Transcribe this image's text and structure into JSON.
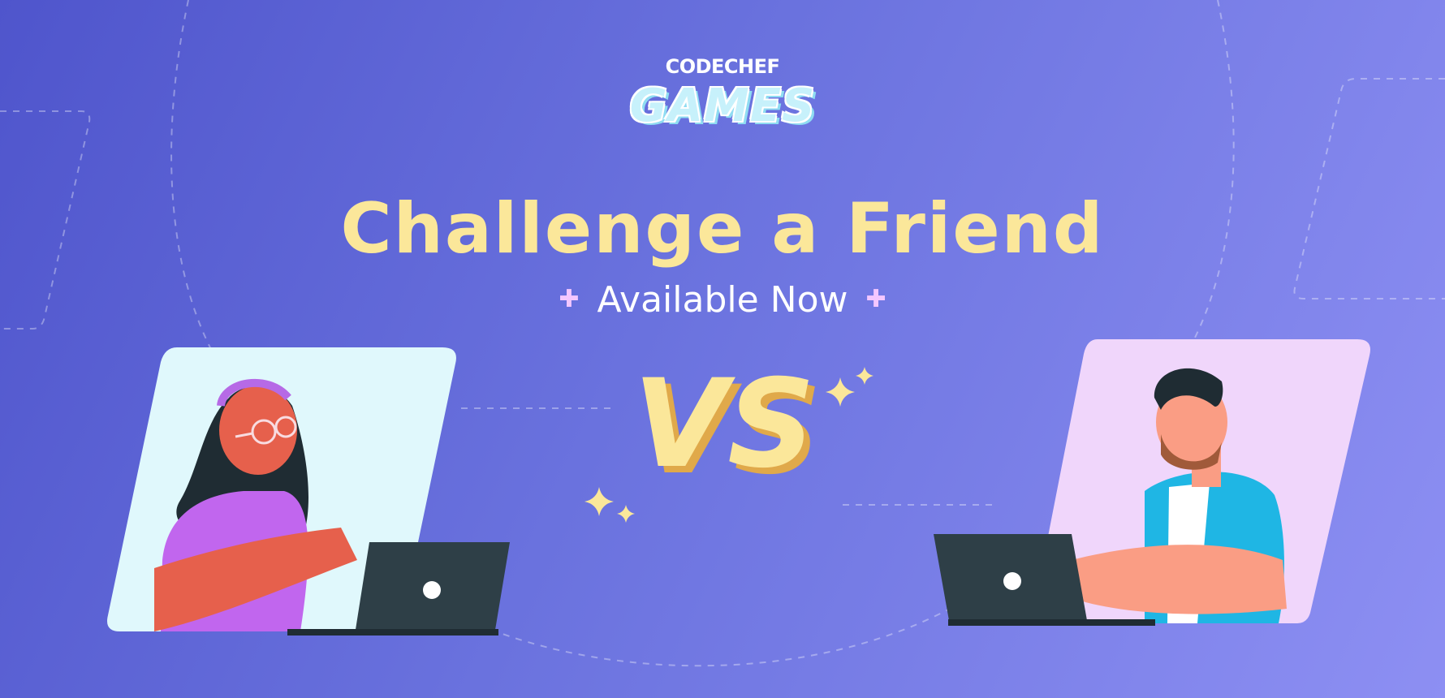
{
  "brand": {
    "top": "CODECHEF",
    "name": "GAMES"
  },
  "headline": "Challenge a Friend",
  "subline": "Available Now",
  "vs_label": "VS",
  "colors": {
    "background_start": "#4f55cc",
    "background_end": "#8d8ff3",
    "headline": "#fbe79a",
    "left_panel": "#e0f8fc",
    "right_panel": "#f0d6fb"
  }
}
